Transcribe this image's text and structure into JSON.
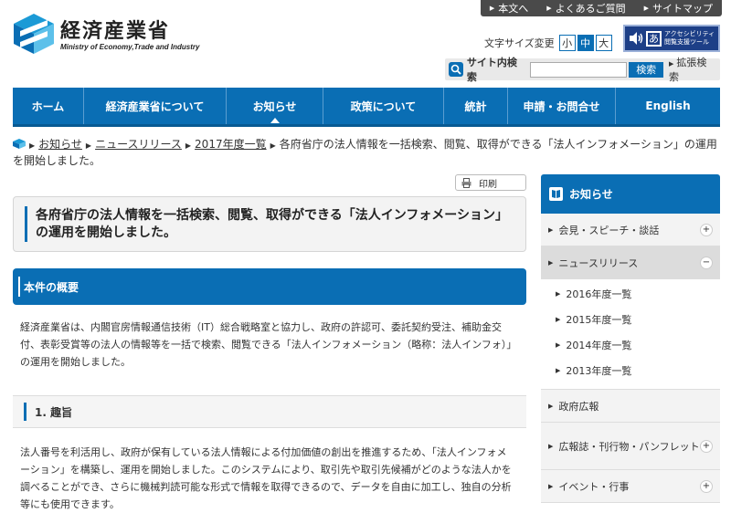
{
  "header": {
    "logo_jp": "経済産業省",
    "logo_en": "Ministry of Economy,Trade and Industry",
    "top_links": [
      "本文へ",
      "よくあるご質問",
      "サイトマップ"
    ],
    "font_size_label": "文字サイズ変更",
    "font_sizes": [
      "小",
      "中",
      "大"
    ],
    "accessibility": {
      "glyph": "あ",
      "line1": "アクセシビリティ",
      "line2": "閲覧支援ツール"
    },
    "search": {
      "label": "サイト内検索",
      "value": "",
      "button": "検索",
      "extended": "拡張検索"
    }
  },
  "nav": {
    "items": [
      "ホーム",
      "経済産業省について",
      "お知らせ",
      "政策について",
      "統計",
      "申請・お問合せ",
      "English"
    ],
    "active_index": 2
  },
  "breadcrumb": {
    "links": [
      "お知らせ",
      "ニュースリリース",
      "2017年度一覧"
    ],
    "current": "各府省庁の法人情報を一括検索、閲覧、取得ができる「法人インフォメーション」の運用を開始しました。"
  },
  "main": {
    "print_label": "印刷",
    "title": "各府省庁の法人情報を一括検索、閲覧、取得ができる「法人インフォメーション」の運用を開始しました。",
    "section1_title": "本件の概要",
    "section1_body": "経済産業省は、内閣官房情報通信技術（IT）総合戦略室と協力し、政府の許認可、委託契約受注、補助金交付、表彰受賞等の法人の情報等を一括で検索、閲覧できる「法人インフォメーション（略称：法人インフォ）」の運用を開始しました。",
    "subsection1_title": "1. 趣旨",
    "subsection1_body": "法人番号を利活用し、政府が保有している法人情報による付加価値の創出を推進するため、「法人インフォメーション」を構築し、運用を開始しました。このシステムにより、取引先や取引先候補がどのような法人かを調べることができ、さらに機械判読可能な形式で情報を取得できるので、データを自由に加工し、独自の分析等にも使用できます。"
  },
  "sidebar": {
    "title": "お知らせ",
    "items": [
      {
        "label": "会見・スピーチ・談話",
        "toggle": "+"
      },
      {
        "label": "ニュースリリース",
        "toggle": "−",
        "open": true,
        "children": [
          "2016年度一覧",
          "2015年度一覧",
          "2014年度一覧",
          "2013年度一覧"
        ]
      },
      {
        "label": "政府広報"
      },
      {
        "label": "広報誌・刊行物・パンフレット",
        "toggle": "+"
      },
      {
        "label": "イベント・行事",
        "toggle": "+"
      }
    ]
  },
  "colors": {
    "brand_blue": "#0a6eb4",
    "dark_bar": "#4a4a4a",
    "access_navy": "#1d3f87"
  }
}
